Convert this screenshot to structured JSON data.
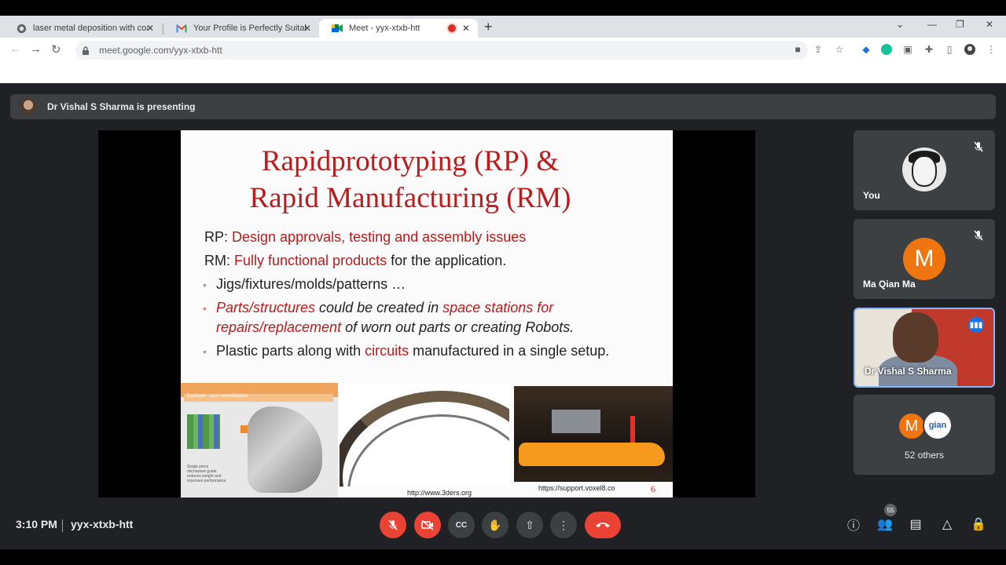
{
  "browser": {
    "tabs": [
      {
        "title": "laser metal deposition with coax",
        "icon": "google-icon"
      },
      {
        "title": "Your Profile is Perfectly Suitable",
        "icon": "gmail-icon"
      },
      {
        "title": "Meet - yyx-xtxb-htt",
        "icon": "meet-icon"
      }
    ],
    "url": "meet.google.com/yyx-xtxb-htt"
  },
  "meet": {
    "presenting_text": "Dr Vishal S Sharma is presenting",
    "slide": {
      "title_line1": "Rapidprototyping (RP) &",
      "title_line2": "Rapid Manufacturing (RM)",
      "rp_prefix": "RP: ",
      "rp_text": "Design approvals, testing and assembly issues",
      "rm_prefix": "RM: ",
      "rm_text_red": "Fully functional products",
      "rm_text_rest": " for the application.",
      "bullet1": "Jigs/fixtures/molds/patterns …",
      "bullet2_a": "Parts/structures",
      "bullet2_b": " could be created in ",
      "bullet2_c": "space stations for",
      "bullet2_d": "repairs/replacement",
      "bullet2_e": " of worn out parts or creating Robots.",
      "bullet3_a": "Plastic parts along with ",
      "bullet3_b": "circuits",
      "bullet3_c": " manufactured in a single setup.",
      "img1_header": "Example – part consolidation",
      "img1_caption": "Single piece microwave guide reduces weight and improves performance",
      "caption_mid": "http://www.3ders.org",
      "caption_right": "https://support.voxel8.co",
      "page_number": "6"
    },
    "participants": [
      {
        "name": "You",
        "muted": true
      },
      {
        "name": "Ma Qian Ma",
        "initial": "M",
        "muted": true
      },
      {
        "name": "Dr Vishal S Sharma",
        "speaking": true
      }
    ],
    "others": {
      "initial": "M",
      "logo_text": "gian",
      "label": "52 others"
    },
    "bottom": {
      "time": "3:10 PM",
      "meeting_code": "yyx-xtxb-htt",
      "people_count": "55"
    }
  },
  "colors": {
    "accent_red": "#ea4335",
    "slide_red": "#b81c1c",
    "avatar_orange": "#f0750f",
    "tile_bg": "#3c4043"
  }
}
